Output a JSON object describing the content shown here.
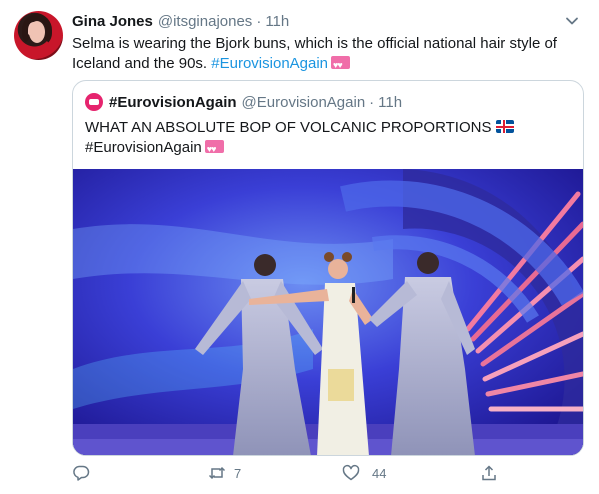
{
  "tweet": {
    "author_name": "Gina Jones",
    "author_handle": "@itsginajones",
    "separator": "·",
    "time": "11h",
    "text": "Selma is wearing the Bjork buns, which is the official national hair style of Iceland and the 90s.",
    "hashtag": "#EurovisionAgain"
  },
  "quoted": {
    "author_name": "#EurovisionAgain",
    "author_handle": "@EurovisionAgain",
    "separator": "·",
    "time": "11h",
    "text": "WHAT AN ABSOLUTE BOP OF VOLCANIC PROPORTIONS",
    "hashtag": "#EurovisionAgain"
  },
  "actions": {
    "reply_count": "",
    "retweet_count": "7",
    "like_count": "44"
  },
  "icons": {
    "reply": "reply-icon",
    "retweet": "retweet-icon",
    "like": "heart-icon",
    "share": "share-icon",
    "menu": "chevron-down-icon",
    "flag": "iceland-flag-icon",
    "emoji": "love-letter-icon"
  },
  "colors": {
    "link": "#1b95e0",
    "muted": "#657786",
    "border": "#ccd6dd"
  }
}
